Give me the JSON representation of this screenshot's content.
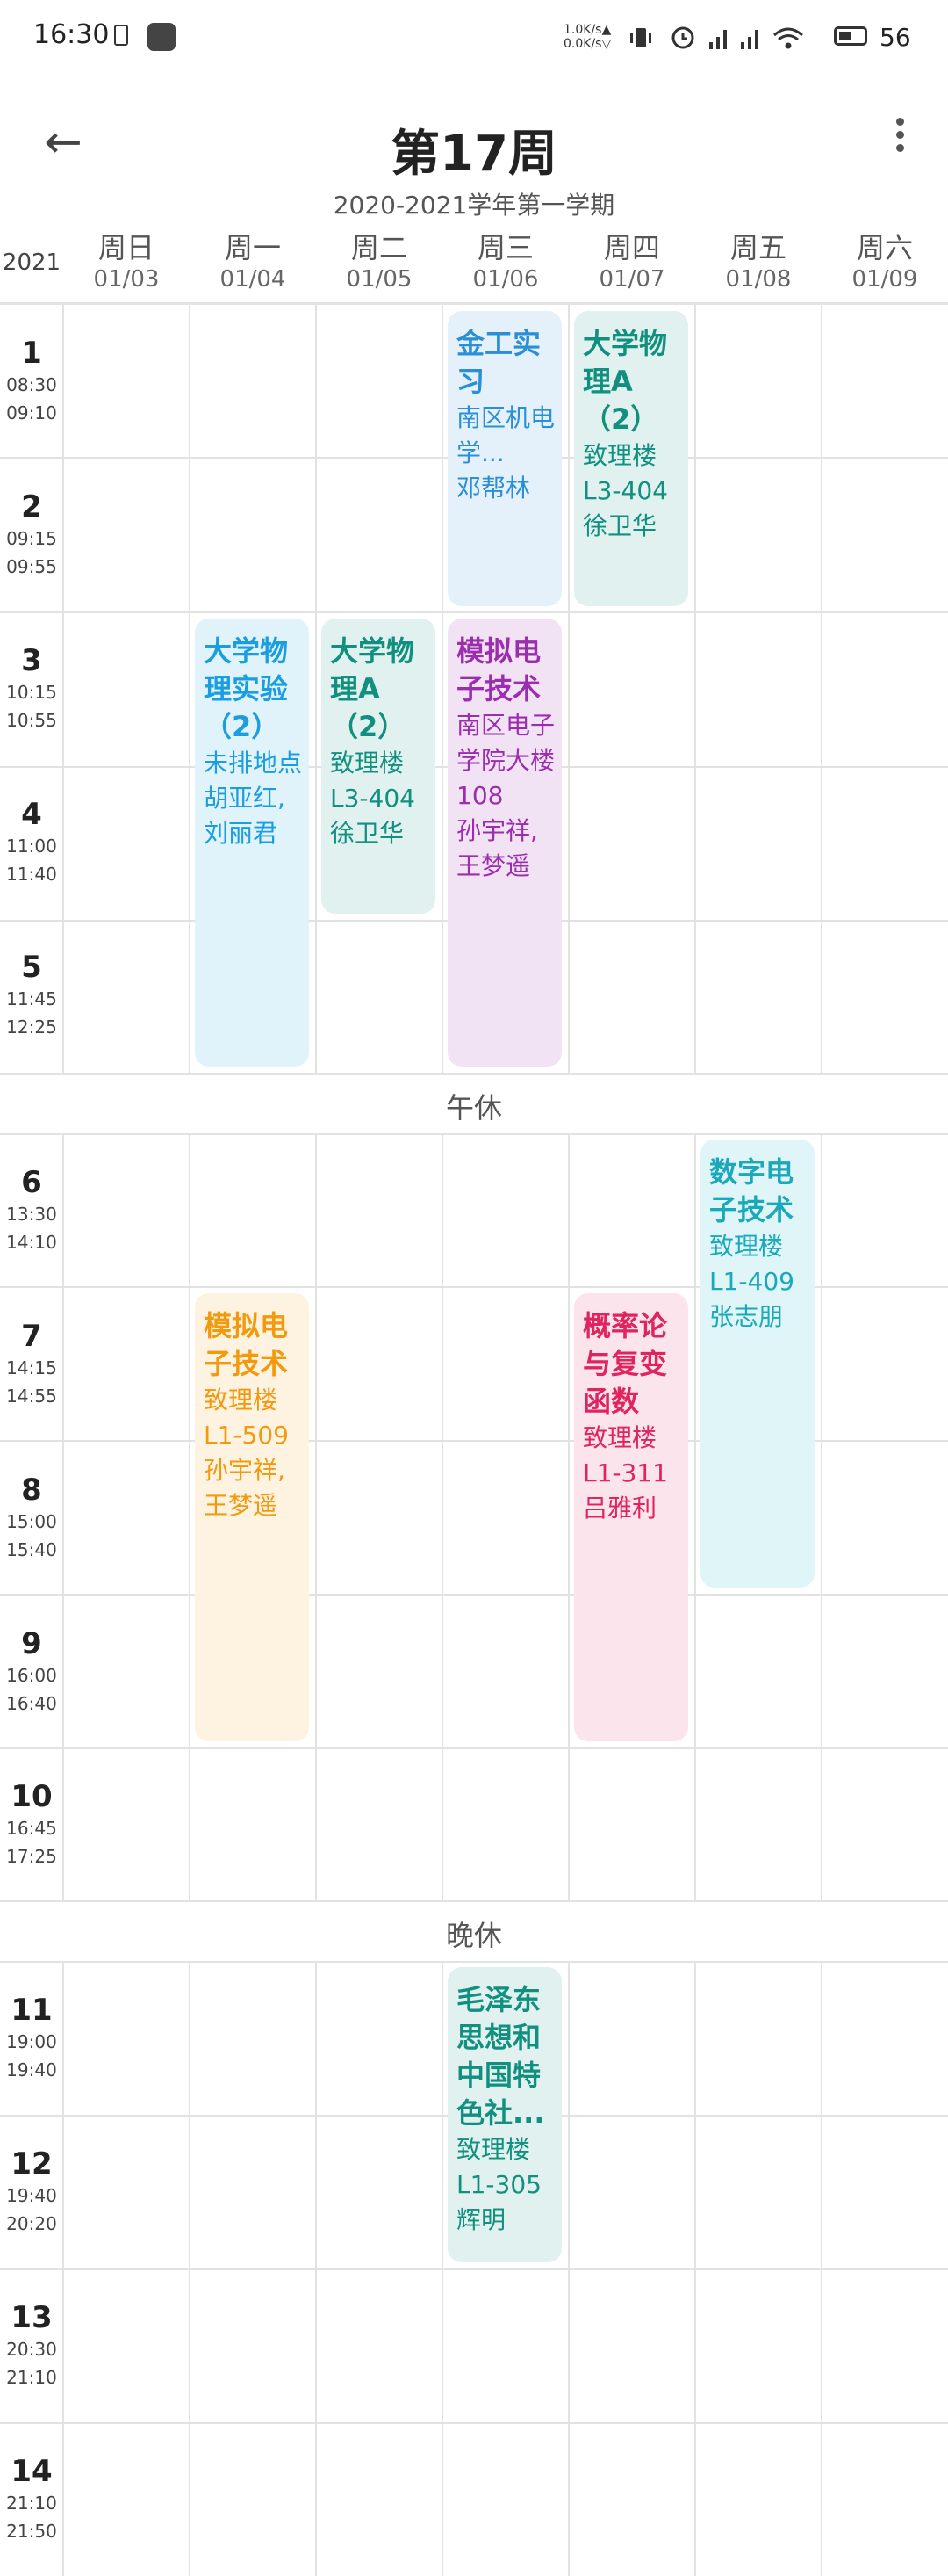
{
  "status_bar": {
    "time": "16:30",
    "net_up": "1.0K/s▲",
    "net_down": "0.0K/s▽",
    "battery": "56"
  },
  "header": {
    "title": "第17周",
    "subtitle": "2020-2021学年第一学期",
    "year": "2021"
  },
  "days": [
    {
      "name": "周日",
      "date": "01/03"
    },
    {
      "name": "周一",
      "date": "01/04"
    },
    {
      "name": "周二",
      "date": "01/05"
    },
    {
      "name": "周三",
      "date": "01/06"
    },
    {
      "name": "周四",
      "date": "01/07"
    },
    {
      "name": "周五",
      "date": "01/08"
    },
    {
      "name": "周六",
      "date": "01/09"
    }
  ],
  "slots": [
    {
      "n": "1",
      "start": "08:30",
      "end": "09:10"
    },
    {
      "n": "2",
      "start": "09:15",
      "end": "09:55"
    },
    {
      "n": "3",
      "start": "10:15",
      "end": "10:55"
    },
    {
      "n": "4",
      "start": "11:00",
      "end": "11:40"
    },
    {
      "n": "5",
      "start": "11:45",
      "end": "12:25"
    },
    {
      "n": "6",
      "start": "13:30",
      "end": "14:10"
    },
    {
      "n": "7",
      "start": "14:15",
      "end": "14:55"
    },
    {
      "n": "8",
      "start": "15:00",
      "end": "15:40"
    },
    {
      "n": "9",
      "start": "16:00",
      "end": "16:40"
    },
    {
      "n": "10",
      "start": "16:45",
      "end": "17:25"
    },
    {
      "n": "11",
      "start": "19:00",
      "end": "19:40"
    },
    {
      "n": "12",
      "start": "19:40",
      "end": "20:20"
    },
    {
      "n": "13",
      "start": "20:30",
      "end": "21:10"
    },
    {
      "n": "14",
      "start": "21:10",
      "end": "21:50"
    }
  ],
  "breaks": {
    "noon": "午休",
    "evening": "晚休"
  },
  "courses": [
    {
      "name": "金工实习",
      "location": "南区机电学...",
      "teacher": "邓帮林",
      "color": "#2a8fd6",
      "bg": "#e4f1fb"
    },
    {
      "name": "大学物理A（2）",
      "location": "致理楼L3-404",
      "teacher": "徐卫华",
      "color": "#11907f",
      "bg": "#e1f1ef"
    },
    {
      "name": "大学物理实验（2）",
      "location": "未排地点",
      "teacher": "胡亚红,刘丽君",
      "color": "#1a9ee0",
      "bg": "#e0f3fb"
    },
    {
      "name": "大学物理A（2）",
      "location": "致理楼L3-404",
      "teacher": "徐卫华",
      "color": "#11907f",
      "bg": "#e1f1ef"
    },
    {
      "name": "模拟电子技术",
      "location": "南区电子学院大楼108",
      "teacher": "孙宇祥,王梦遥",
      "color": "#9c2cb0",
      "bg": "#f1e3f4"
    },
    {
      "name": "数字电子技术",
      "location": "致理楼L1-409",
      "teacher": "张志朋",
      "color": "#1aa9bb",
      "bg": "#e0f5f7"
    },
    {
      "name": "模拟电子技术",
      "location": "致理楼L1-509",
      "teacher": "孙宇祥,王梦遥",
      "color": "#f29a0e",
      "bg": "#fef2e0"
    },
    {
      "name": "概率论与复变函数",
      "location": "致理楼L1-311",
      "teacher": "吕雅利",
      "color": "#e0245e",
      "bg": "#fbe4ec"
    },
    {
      "name": "毛泽东思想和中国特色社...",
      "location": "致理楼L1-305",
      "teacher": "辉明",
      "color": "#11907f",
      "bg": "#e1f1ef"
    }
  ]
}
